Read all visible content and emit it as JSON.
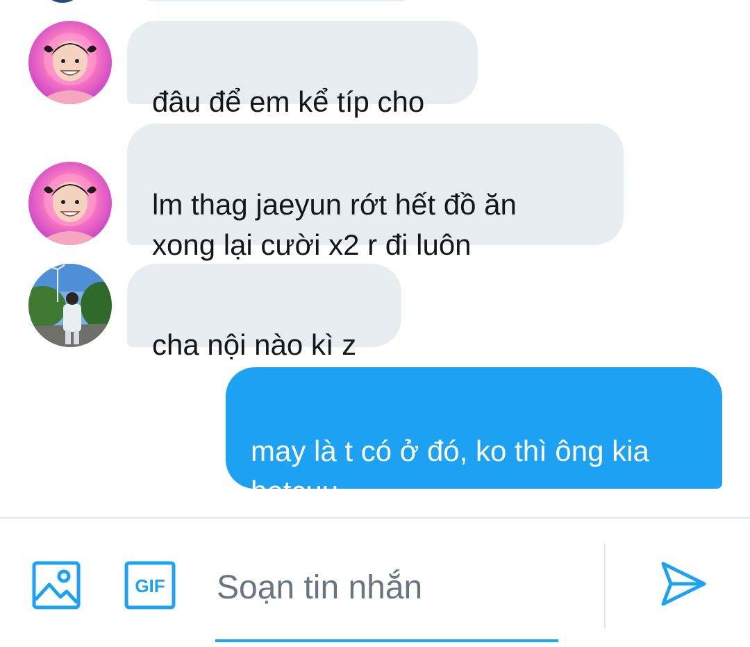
{
  "conversation": {
    "messages": [
      {
        "direction": "incoming",
        "sender_avatar": "pink-avatar",
        "text": "đâu để em kể típ cho"
      },
      {
        "direction": "incoming",
        "sender_avatar": "pink-avatar",
        "text": "lm thag jaeyun rớt hết đồ ăn\nxong lại cười x2 r đi luôn"
      },
      {
        "direction": "incoming",
        "sender_avatar": "outdoor-avatar",
        "text": "cha nội nào kì z"
      },
      {
        "direction": "outgoing",
        "text": "may là t có ở đó, ko thì ông kia\nhetcuu"
      }
    ]
  },
  "composer": {
    "placeholder": "Soạn tin nhắn",
    "value": "",
    "gif_label": "GIF",
    "icons": {
      "image": "image-icon",
      "gif": "gif-icon",
      "send": "send-icon"
    }
  },
  "colors": {
    "accent": "#1da1f2",
    "incoming_bubble": "#e6ecf0",
    "placeholder": "#66757f",
    "divider": "#e1e8ed"
  }
}
